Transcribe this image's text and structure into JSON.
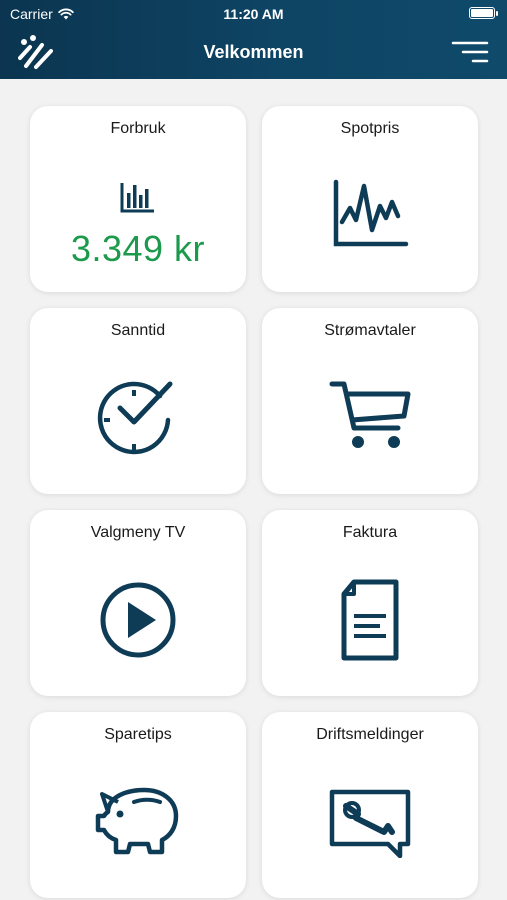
{
  "status_bar": {
    "carrier": "Carrier",
    "time": "11:20 AM"
  },
  "header": {
    "title": "Velkommen",
    "logo_icon": "company-logo",
    "menu_icon": "menu-icon",
    "gradient_start": "#0b3550",
    "gradient_end": "#0f4a6b"
  },
  "colors": {
    "icon": "#0e3b55",
    "value": "#1b9a4b",
    "card_bg": "#ffffff",
    "page_bg": "#f2f2f2"
  },
  "tiles": [
    {
      "label": "Forbruk",
      "icon": "bar-chart-icon",
      "value": "3.349 kr"
    },
    {
      "label": "Spotpris",
      "icon": "line-chart-icon"
    },
    {
      "label": "Sanntid",
      "icon": "clock-check-icon"
    },
    {
      "label": "Strømavtaler",
      "icon": "shopping-cart-icon"
    },
    {
      "label": "Valgmeny TV",
      "icon": "play-icon"
    },
    {
      "label": "Faktura",
      "icon": "document-icon"
    },
    {
      "label": "Sparetips",
      "icon": "piggy-bank-icon"
    },
    {
      "label": "Driftsmeldinger",
      "icon": "wrench-message-icon"
    }
  ]
}
